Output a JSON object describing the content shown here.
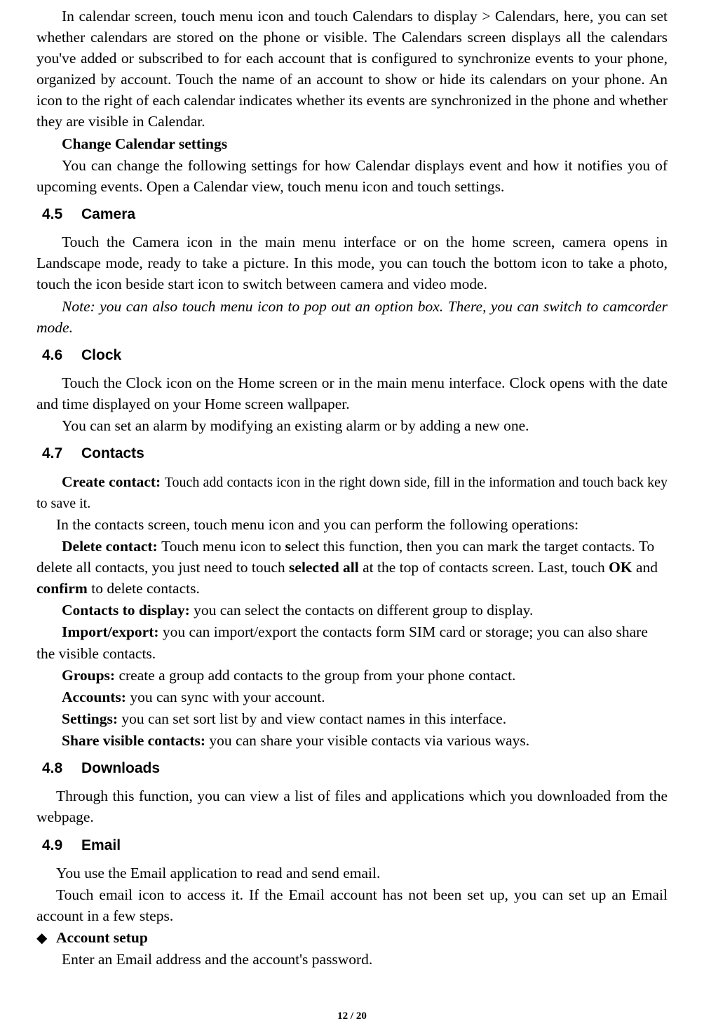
{
  "para_calendar_intro": "In calendar screen, touch menu icon and touch Calendars to display > Calendars, here, you can set whether calendars are stored on the phone or visible. The Calendars screen displays all the calendars you've added or subscribed to for each account that is configured to synchronize events to your phone, organized by account. Touch the name of an account to show or hide its calendars on your phone. An icon to the right of each calendar indicates whether its events are synchronized in the phone and whether they are visible in Calendar.",
  "h_change_cal": "Change Calendar settings",
  "p_change_cal": "You can change the following settings for how Calendar displays event and how it notifies you of upcoming events. Open a Calendar view, touch menu icon and touch settings.",
  "s45_num": "4.5",
  "s45_title": "Camera",
  "p45a": "Touch the Camera icon in the main menu interface or on the home screen, camera opens in Landscape mode, ready to take a picture. In this mode, you can touch the bottom icon to take a photo, touch the icon beside start icon to switch between camera and video mode.",
  "p45_note": "Note: you can also touch menu icon to pop out an option box. There, you can switch to camcorder mode.",
  "s46_num": "4.6",
  "s46_title": "Clock",
  "p46a": "Touch the Clock icon on the Home screen or in the main menu interface. Clock opens with the date and time displayed on your Home screen wallpaper.",
  "p46b": "You can set an alarm by modifying an existing alarm or by adding a new one.",
  "s47_num": "4.7",
  "s47_title": "Contacts",
  "lbl_create": "Create contact: ",
  "p_create": "Touch add contacts icon in the right down side, fill in the information and touch back key to save it.",
  "p_contacts_ops": "In the contacts screen, touch menu icon and you can perform the following operations:",
  "lbl_delete": "Delete contact: ",
  "p_delete_a": "Touch menu icon to ",
  "p_delete_s": "s",
  "p_delete_b": "elect this function, then you can mark the target contacts. To delete all contacts, you just need to touch ",
  "p_delete_c": "selected all",
  "p_delete_d": " at the top of contacts screen. Last, touch ",
  "p_delete_e": "OK",
  "p_delete_f": " and ",
  "p_delete_g": "confirm",
  "p_delete_h": " to delete contacts.",
  "lbl_display": "Contacts to display: ",
  "p_display": "you can select the contacts on different group to display.",
  "lbl_import": "Import/export: ",
  "p_import": "you can import/export the contacts form SIM card or storage; you can also share the visible contacts.",
  "lbl_groups": "Groups: ",
  "p_groups": "create a group add contacts to the group from your phone contact.",
  "lbl_accounts": "Accounts: ",
  "p_accounts": "you can sync with your account.",
  "lbl_settings": "Settings: ",
  "p_settings": "you can set sort list by and view contact names in this interface.",
  "lbl_share": "Share visible contacts: ",
  "p_share": "you can share your visible contacts via various ways.",
  "s48_num": "4.8",
  "s48_title": "Downloads",
  "p48": "Through this function, you can view a list of files and applications which you downloaded from the webpage.",
  "s49_num": "4.9",
  "s49_title": "Email",
  "p49a": "You use the Email application to read and send email.",
  "p49b": "Touch email icon to access it. If the Email account has not been set up, you can set up an Email account in a few steps.",
  "bullet_glyph": "◆",
  "lbl_account_setup": "Account setup",
  "p_account_setup": "Enter an Email address and the account's password.",
  "footer": "12 / 20"
}
